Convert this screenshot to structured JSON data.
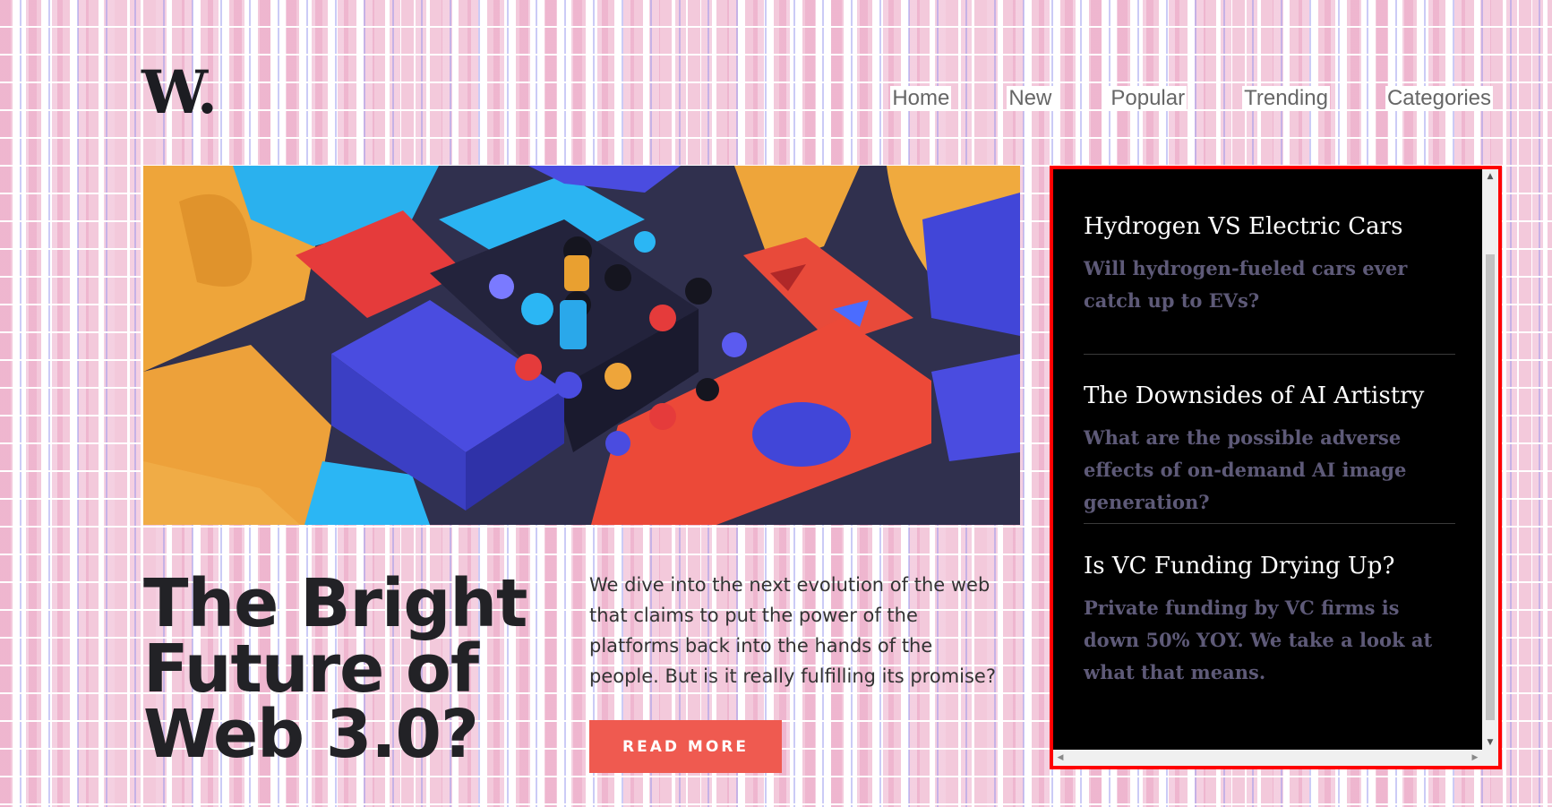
{
  "logo": "W.",
  "nav": [
    "Home",
    "New",
    "Popular",
    "Trending",
    "Categories"
  ],
  "hero": {
    "headline_lines": [
      "The Bright",
      "Future of",
      "Web 3.0?"
    ],
    "blurb": "We dive into the next evolution of the web that claims to put the power of the platforms back into the hands of the people. But is it really fulfilling its promise?",
    "button": "READ MORE"
  },
  "sidebar": {
    "items": [
      {
        "title": "Hydrogen VS Electric Cars",
        "desc": "Will hydrogen-fueled cars ever catch up to EVs?"
      },
      {
        "title": "The Downsides of AI Artistry",
        "desc": "What are the possible adverse effects of on-demand AI image generation?"
      },
      {
        "title": "Is VC Funding Drying Up?",
        "desc": "Private funding by VC firms is down 50% YOY. We take a look at what that means."
      }
    ]
  },
  "colors": {
    "accent": "#ef5a50",
    "highlight_border": "#ff0000",
    "desc_text": "#5e5a78"
  }
}
